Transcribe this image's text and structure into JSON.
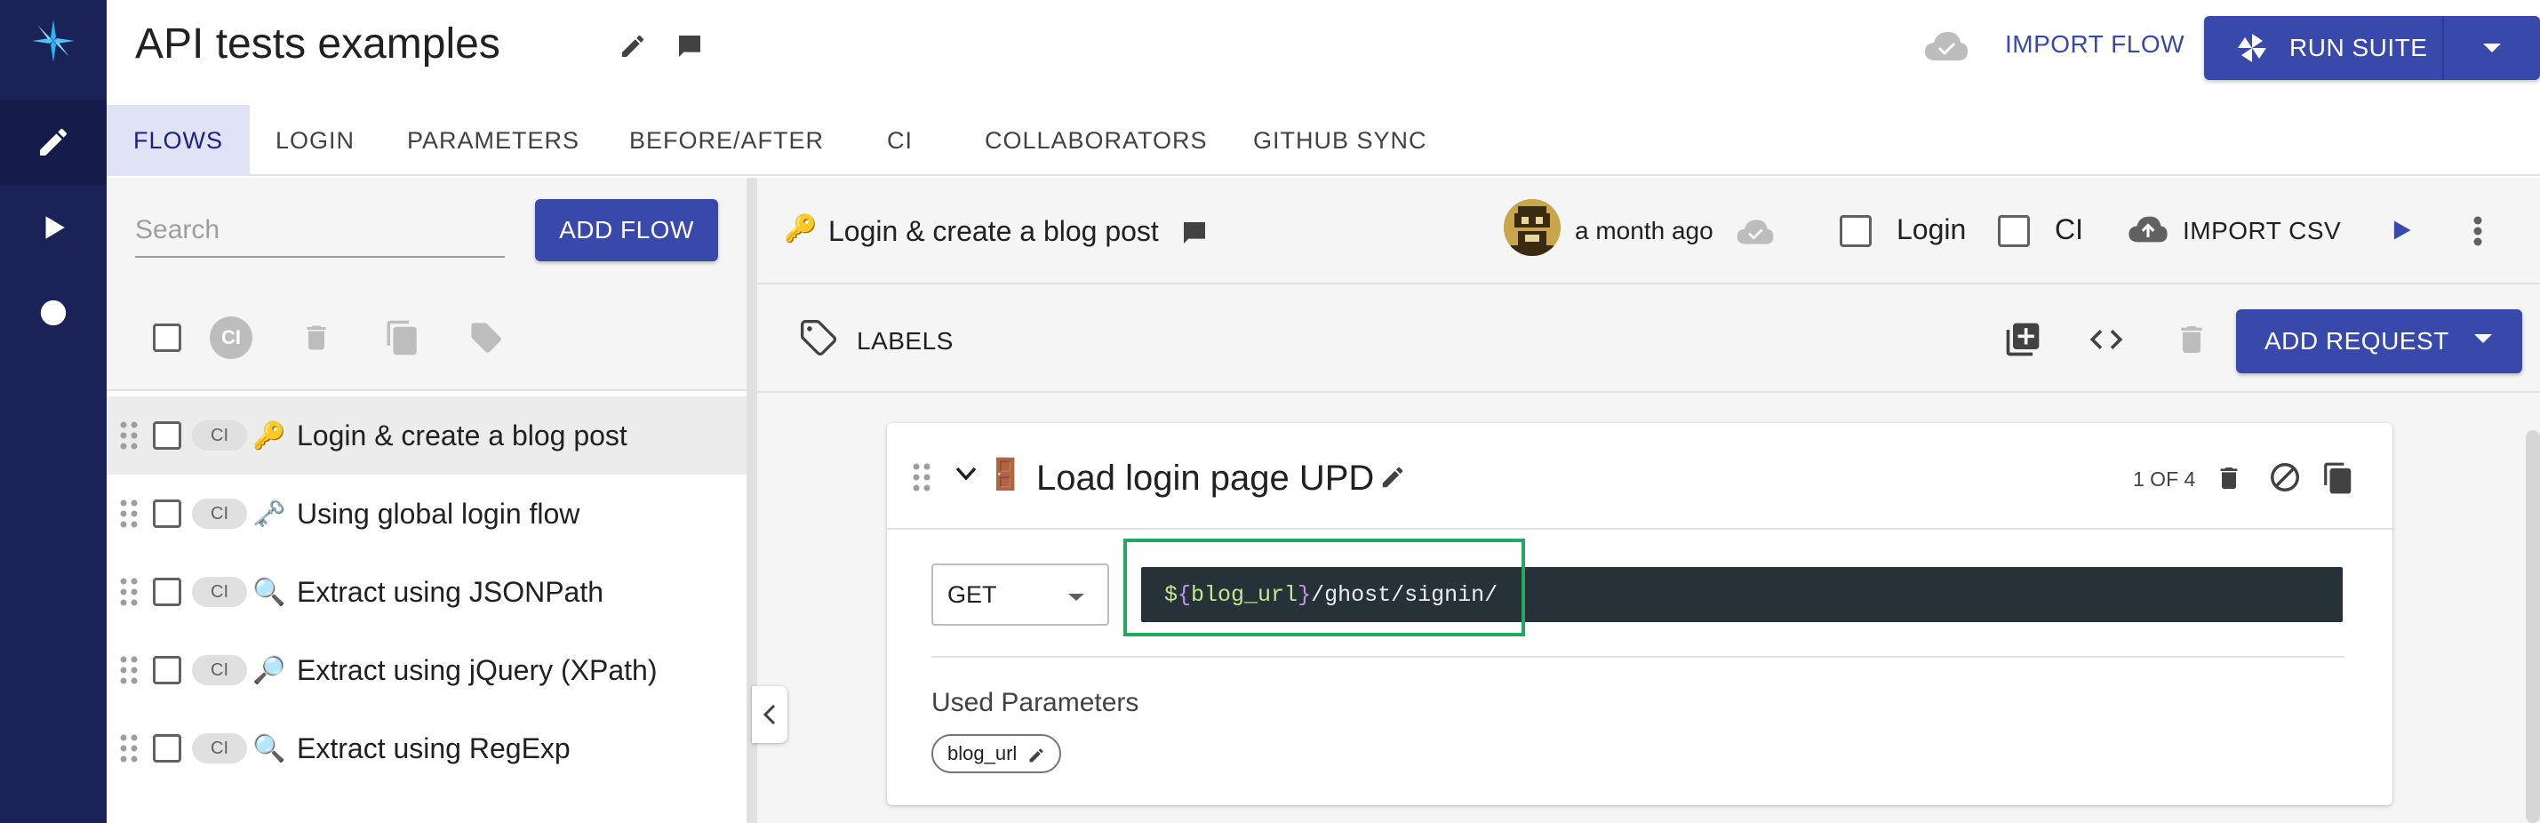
{
  "header": {
    "title": "API tests examples",
    "import_flow_label": "IMPORT FLOW",
    "run_suite_label": "RUN SUITE"
  },
  "tabs": [
    {
      "label": "FLOWS"
    },
    {
      "label": "LOGIN"
    },
    {
      "label": "PARAMETERS"
    },
    {
      "label": "BEFORE/AFTER"
    },
    {
      "label": "CI"
    },
    {
      "label": "COLLABORATORS"
    },
    {
      "label": "GITHUB SYNC"
    }
  ],
  "sidebar": {
    "search_placeholder": "Search",
    "add_flow_label": "ADD FLOW",
    "bulk_ci_label": "CI",
    "flows": [
      {
        "ci": "CI",
        "emoji": "🔑",
        "label": "Login & create a blog post"
      },
      {
        "ci": "CI",
        "emoji": "🗝️",
        "label": "Using global login flow"
      },
      {
        "ci": "CI",
        "emoji": "🔍",
        "label": "Extract using JSONPath"
      },
      {
        "ci": "CI",
        "emoji": "🔎",
        "label": "Extract using jQuery (XPath)"
      },
      {
        "ci": "CI",
        "emoji": "🔍",
        "label": "Extract using RegExp"
      }
    ]
  },
  "flow": {
    "emoji": "🔑",
    "title": "Login & create a blog post",
    "updated": "a month ago",
    "login_label": "Login",
    "ci_label": "CI",
    "import_csv_label": "IMPORT CSV",
    "labels_label": "LABELS",
    "add_request_label": "ADD REQUEST"
  },
  "request": {
    "emoji": "🚪",
    "title": "Load login page UPD",
    "count": "1 OF 4",
    "method": "GET",
    "url_prefix": "$",
    "url_open": "{",
    "url_param": "blog_url",
    "url_close": "}",
    "url_path": "/ghost/signin/",
    "used_parameters_label": "Used Parameters",
    "param_chip": "blog_url"
  },
  "colors": {
    "primary": "#3949ab",
    "rail": "#1a2257",
    "highlight": "#22a861",
    "url_bg": "#263238"
  }
}
